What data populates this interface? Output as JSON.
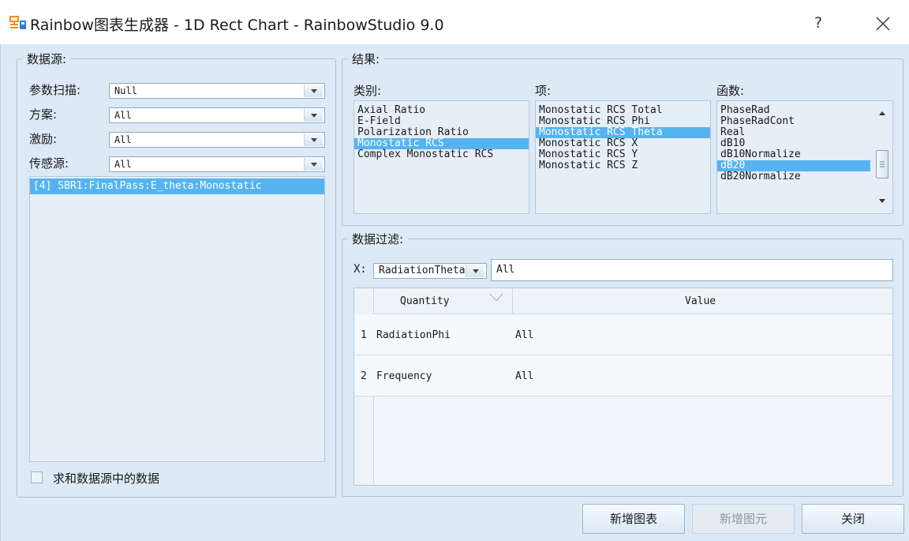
{
  "window": {
    "title": "Rainbow图表生成器 - 1D Rect Chart - RainbowStudio 9.0",
    "help_label": "?"
  },
  "datasource": {
    "legend": "数据源:",
    "param_sweep_label": "参数扫描:",
    "param_sweep_value": "Null",
    "scheme_label": "方案:",
    "scheme_value": "All",
    "excitation_label": "激励:",
    "excitation_value": "All",
    "sensor_label": "传感源:",
    "sensor_value": "All",
    "sources": [
      "[4] SBR1:FinalPass:E_theta:Monostatic"
    ],
    "sum_checkbox_label": "求和数据源中的数据",
    "sum_checked": false
  },
  "result": {
    "legend": "结果:",
    "category_label": "类别:",
    "categories": [
      "Axial Ratio",
      "E-Field",
      "Polarization Ratio",
      "Monostatic RCS",
      "Complex Monostatic RCS"
    ],
    "selected_category": 3,
    "item_label": "项:",
    "items": [
      "Monostatic RCS Total",
      "Monostatic RCS Phi",
      "Monostatic RCS Theta",
      "Monostatic RCS X",
      "Monostatic RCS Y",
      "Monostatic RCS Z"
    ],
    "selected_item": 2,
    "function_label": "函数:",
    "functions": [
      "PhaseRad",
      "PhaseRadCont",
      "Real",
      "dB10",
      "dB10Normalize",
      "dB20",
      "dB20Normalize"
    ],
    "selected_function": 5
  },
  "filter": {
    "legend": "数据过滤:",
    "x_label": "X:",
    "x_combo_value": "RadiationTheta",
    "x_value": "All",
    "columns": [
      "Quantity",
      "Value"
    ],
    "rows": [
      {
        "index": "1",
        "quantity": "RadiationPhi",
        "value": "All"
      },
      {
        "index": "2",
        "quantity": "Frequency",
        "value": "All"
      }
    ]
  },
  "buttons": {
    "add_chart": "新增图表",
    "add_element": "新增图元",
    "close": "关闭"
  },
  "colors": {
    "selection": "#55b3f0",
    "client_bg": "#dde9f5",
    "app_icon_orange": "#f28c1e",
    "app_icon_blue": "#2f7bd1"
  }
}
